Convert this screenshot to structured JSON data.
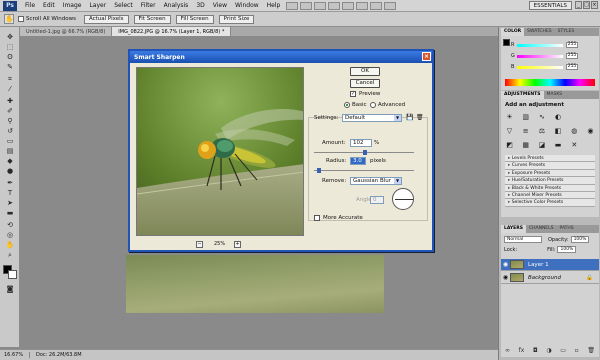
{
  "menubar": {
    "logo": "Ps",
    "items": [
      "File",
      "Edit",
      "Image",
      "Layer",
      "Select",
      "Filter",
      "Analysis",
      "3D",
      "View",
      "Window",
      "Help"
    ],
    "workspace": "ESSENTIALS"
  },
  "options": {
    "scroll_all_label": "Scroll All Windows",
    "buttons": [
      "Actual Pixels",
      "Fit Screen",
      "Fill Screen",
      "Print Size"
    ]
  },
  "tabs": [
    {
      "label": "Untitled-1.jpg @ 66.7% (RGB/8)",
      "active": false
    },
    {
      "label": "IMG_0822.JPG @ 16.7% (Layer 1, RGB/8) *",
      "active": true
    }
  ],
  "status": {
    "zoom": "16.67%",
    "doc": "Doc: 26.2M/63.8M"
  },
  "panels": {
    "color_tabs": [
      "COLOR",
      "SWATCHES",
      "STYLES"
    ],
    "channels": [
      {
        "name": "R",
        "value": "255"
      },
      {
        "name": "G",
        "value": "255"
      },
      {
        "name": "B",
        "value": "255"
      }
    ],
    "adjust_tabs": [
      "ADJUSTMENTS",
      "MASKS"
    ],
    "adjust_title": "Add an adjustment",
    "presets": [
      "Levels Presets",
      "Curves Presets",
      "Exposure Presets",
      "Hue/Saturation Presets",
      "Black & White Presets",
      "Channel Mixer Presets",
      "Selective Color Presets"
    ],
    "layers_tabs": [
      "LAYERS",
      "CHANNELS",
      "PATHS"
    ],
    "blend_mode": "Normal",
    "opacity_label": "Opacity:",
    "opacity_value": "100%",
    "fill_label": "Fill:",
    "fill_value": "100%",
    "lock_label": "Lock:",
    "layers": [
      {
        "name": "Layer 1",
        "selected": true
      },
      {
        "name": "Background",
        "selected": false
      }
    ]
  },
  "dialog": {
    "title": "Smart Sharpen",
    "ok": "OK",
    "cancel": "Cancel",
    "preview": "Preview",
    "basic": "Basic",
    "advanced": "Advanced",
    "settings_label": "Settings:",
    "settings_value": "Default",
    "amount_label": "Amount:",
    "amount_value": "102",
    "amount_unit": "%",
    "radius_label": "Radius:",
    "radius_value": "3.0",
    "radius_unit": "pixels",
    "remove_label": "Remove:",
    "remove_value": "Gaussian Blur",
    "angle_label": "Angle:",
    "angle_value": "0",
    "more_accurate": "More Accurate",
    "zoom_value": "25%",
    "amount_fraction": 0.51,
    "radius_fraction": 0.05
  }
}
